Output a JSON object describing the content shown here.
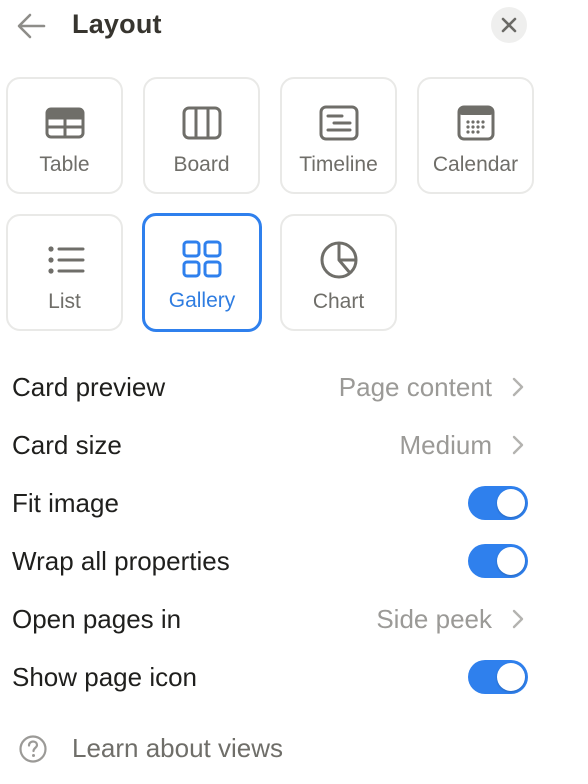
{
  "header": {
    "title": "Layout"
  },
  "layouts": [
    {
      "label": "Table",
      "icon": "table-icon",
      "selected": false
    },
    {
      "label": "Board",
      "icon": "board-icon",
      "selected": false
    },
    {
      "label": "Timeline",
      "icon": "timeline-icon",
      "selected": false
    },
    {
      "label": "Calendar",
      "icon": "calendar-icon",
      "selected": false
    },
    {
      "label": "List",
      "icon": "list-icon",
      "selected": false
    },
    {
      "label": "Gallery",
      "icon": "gallery-icon",
      "selected": true
    },
    {
      "label": "Chart",
      "icon": "chart-icon",
      "selected": false
    }
  ],
  "settings": {
    "card_preview": {
      "label": "Card preview",
      "value": "Page content"
    },
    "card_size": {
      "label": "Card size",
      "value": "Medium"
    },
    "fit_image": {
      "label": "Fit image",
      "on": true
    },
    "wrap_all_properties": {
      "label": "Wrap all properties",
      "on": true
    },
    "open_pages_in": {
      "label": "Open pages in",
      "value": "Side peek"
    },
    "show_page_icon": {
      "label": "Show page icon",
      "on": true
    }
  },
  "footer": {
    "help_label": "Learn about views"
  },
  "colors": {
    "accent": "#2f80ed",
    "text": "#37352f",
    "muted": "#9b9a97",
    "tile_border": "#e9e9e7"
  }
}
